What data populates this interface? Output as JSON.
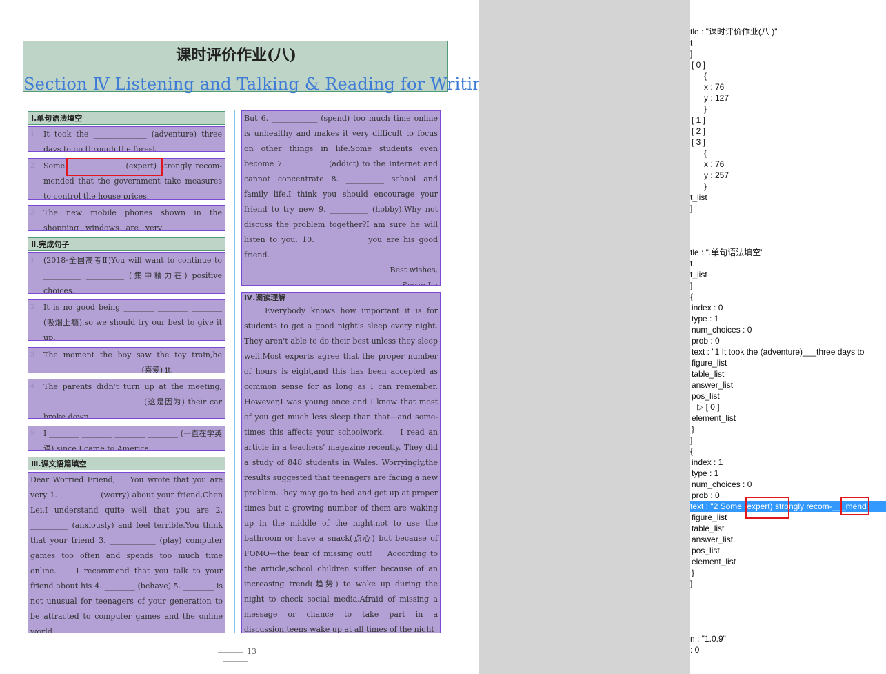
{
  "doc": {
    "title": "课时评价作业(八)",
    "subtitle": "Section Ⅳ  Listening and Talking & Reading for Writing",
    "page_number": "13",
    "sec1_header": "Ⅰ.单句语法填空",
    "q1_num": "1",
    "q1_text": "It took the ______________ (adventure) three days to go through the forest.",
    "q2_num": "2",
    "q2_text_a": "Some",
    "q2_text_b": "(expert) strongly recom-mended that the government take measures to control the house prices.",
    "q3_num": "3",
    "q3_text": "The new mobile phones shown in the shopping windows are very ______________ (attract).",
    "sec2_header": "Ⅱ.完成句子",
    "s1_num": "1",
    "s1_text": "(2018·全国高考Ⅱ)You will want to continue to __________ __________ (集中精力在) positive choices.",
    "s2_num": "2",
    "s2_text": "It is no good being ________ ________ ________ (吸烟上瘾),so we should try our best to give it up.",
    "s3_num": "3",
    "s3_text": "The moment the boy saw the toy train,he ________ ________ ________ (喜爱) it.",
    "s4_num": "4",
    "s4_text": "The parents didn't turn up at the meeting, ________ ________ ________ (这是因为) their car broke down.",
    "s5_num": "5",
    "s5_text": "I ________ ________ ________ ________ (一直在学英语) since I came to America.",
    "sec3_header": "Ⅲ.课文语篇填空",
    "letter_text": "Dear Worried Friend,    You wrote that you are very 1. __________ (worry) about your friend,Chen Lei.I understand quite well that you are 2. __________ (anxiously) and feel terrible.You think that your friend 3. ____________ (play) computer games too often and spends too much time online.    I recommend that you talk to your friend about his 4. ________ (behave).5. ________ is not unusual for teenagers of your generation to be attracted to computer games and the online world.",
    "letter2_text": "But 6. ____________ (spend) too much time online is unhealthy and makes it very difficult to focus on other things in life.Some students even become 7. __________ (addict) to the Internet and cannot concentrate 8. __________ school and family life.I think you should encourage your friend to try new 9. __________ (hobby).Why not discuss the problem together?I am sure he will listen to you. 10. ____________ you are his good friend.",
    "letter2_close1": "Best wishes,",
    "letter2_close2": "Susan Lu",
    "sec4_header": "Ⅳ.阅读理解",
    "reading_text": "    Everybody knows how important it is for students to get a good night's sleep every night. They aren't able to do their best unless they sleep well.Most experts agree that the proper number of hours is eight,and this has been accepted as common sense for as long as I can remember. However,I was young once and I know that most of you get much less sleep than that—and some-times this affects your schoolwork.    I read an article in a teachers' magazine recently. They did a study of 848 students in Wales. Worryingly,the results suggested that teenagers are facing a new problem.They may go to bed and get up at proper times but a growing number of them are waking up in the middle of the night,not to use the bathroom or have a snack(点心) but because of FOMO—the fear of missing out!    According to the article,school children suffer because of an increasing trend(趋势) to wake up during the night to check social media.Afraid of missing a message or chance to take part in a discussion,teens wake up at all times of the night"
  },
  "panel": {
    "rows": [
      "tle : \"课时评价作业(八 )\"",
      "t",
      "]",
      "[ 0 ]",
      "{",
      "x : 76",
      "y : 127",
      "}",
      "[ 1 ]",
      "[ 2 ]",
      "[ 3 ]",
      "{",
      "x : 76",
      "y : 257",
      "}",
      "t_list",
      "]",
      "tle : \".单句语法填空\"",
      "t",
      "t_list",
      "]",
      "{",
      "index : 0",
      "type : 1",
      "num_choices : 0",
      "prob : 0",
      "text : \"1 It took the  (adventure)___three days to",
      "figure_list",
      "table_list",
      "answer_list",
      "pos_list",
      "▷ [ 0 ]",
      "element_list",
      "}",
      "]",
      "{",
      "index : 1",
      "type : 1",
      "num_choices : 0",
      "prob : 0",
      "text : \"2  Some  (expert) strongly recom-___mend",
      "figure_list",
      "table_list",
      "answer_list",
      "pos_list",
      "element_list",
      "}",
      "]",
      "n : \"1.0.9\"",
      ": 0"
    ]
  }
}
